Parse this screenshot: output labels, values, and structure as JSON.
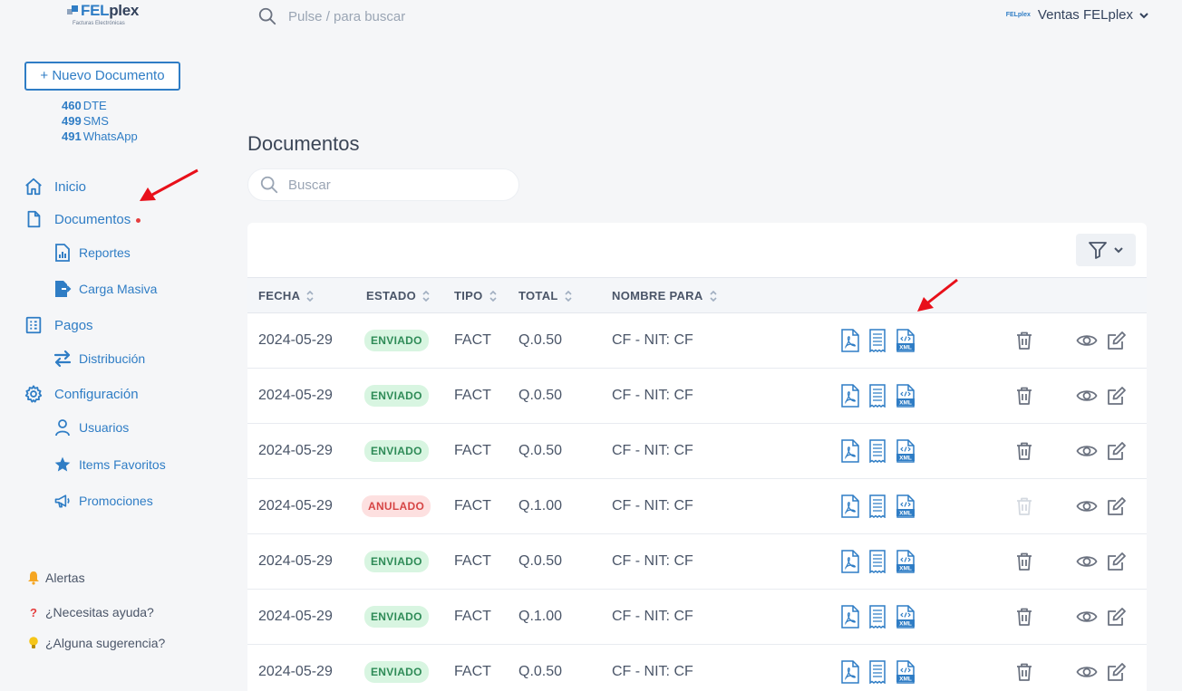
{
  "brand": {
    "name_a": "FEL",
    "name_b": "plex",
    "tagline": "Facturas Electrónicas"
  },
  "sidebar": {
    "new_document": "+ Nuevo Documento",
    "counts": [
      {
        "value": "460",
        "label": "DTE"
      },
      {
        "value": "499",
        "label": "SMS"
      },
      {
        "value": "491",
        "label": "WhatsApp"
      }
    ],
    "nav": {
      "inicio": "Inicio",
      "documentos": "Documentos",
      "reportes": "Reportes",
      "carga_masiva": "Carga Masiva",
      "pagos": "Pagos",
      "distribucion": "Distribución",
      "configuracion": "Configuración",
      "usuarios": "Usuarios",
      "items_favoritos": "Items Favoritos",
      "promociones": "Promociones"
    },
    "bottom": {
      "alertas": "Alertas",
      "ayuda": "¿Necesitas ayuda?",
      "sugerencia": "¿Alguna sugerencia?"
    }
  },
  "topbar": {
    "search_placeholder": "Pulse / para buscar",
    "user_logo": "FELplex",
    "user_name": "Ventas FELplex"
  },
  "main": {
    "title": "Documentos",
    "search_placeholder": "Buscar",
    "columns": {
      "fecha": "FECHA",
      "estado": "ESTADO",
      "tipo": "TIPO",
      "total": "TOTAL",
      "nombre": "NOMBRE PARA"
    },
    "rows": [
      {
        "fecha": "2024-05-29",
        "estado": "ENVIADO",
        "tipo": "FACT",
        "total": "Q.0.50",
        "nombre": "CF - NIT: CF"
      },
      {
        "fecha": "2024-05-29",
        "estado": "ENVIADO",
        "tipo": "FACT",
        "total": "Q.0.50",
        "nombre": "CF - NIT: CF"
      },
      {
        "fecha": "2024-05-29",
        "estado": "ENVIADO",
        "tipo": "FACT",
        "total": "Q.0.50",
        "nombre": "CF - NIT: CF"
      },
      {
        "fecha": "2024-05-29",
        "estado": "ANULADO",
        "tipo": "FACT",
        "total": "Q.1.00",
        "nombre": "CF - NIT: CF"
      },
      {
        "fecha": "2024-05-29",
        "estado": "ENVIADO",
        "tipo": "FACT",
        "total": "Q.0.50",
        "nombre": "CF - NIT: CF"
      },
      {
        "fecha": "2024-05-29",
        "estado": "ENVIADO",
        "tipo": "FACT",
        "total": "Q.1.00",
        "nombre": "CF - NIT: CF"
      },
      {
        "fecha": "2024-05-29",
        "estado": "ENVIADO",
        "tipo": "FACT",
        "total": "Q.0.50",
        "nombre": "CF - NIT: CF"
      }
    ],
    "xml_label": "XML"
  },
  "colors": {
    "accent": "#2f7dc5",
    "ok": "#2e8b57",
    "danger": "#d64545",
    "annotation": "#e8101a"
  },
  "icons": [
    "search-icon",
    "chevron-down-icon",
    "home-icon",
    "document-icon",
    "report-icon",
    "upload-icon",
    "receipt-icon",
    "exchange-icon",
    "gear-icon",
    "user-icon",
    "star-icon",
    "megaphone-icon",
    "bell-icon",
    "question-icon",
    "bulb-icon",
    "filter-icon",
    "sort-icon",
    "pdf-icon",
    "receipt-doc-icon",
    "xml-icon",
    "trash-icon",
    "eye-icon",
    "edit-icon"
  ]
}
